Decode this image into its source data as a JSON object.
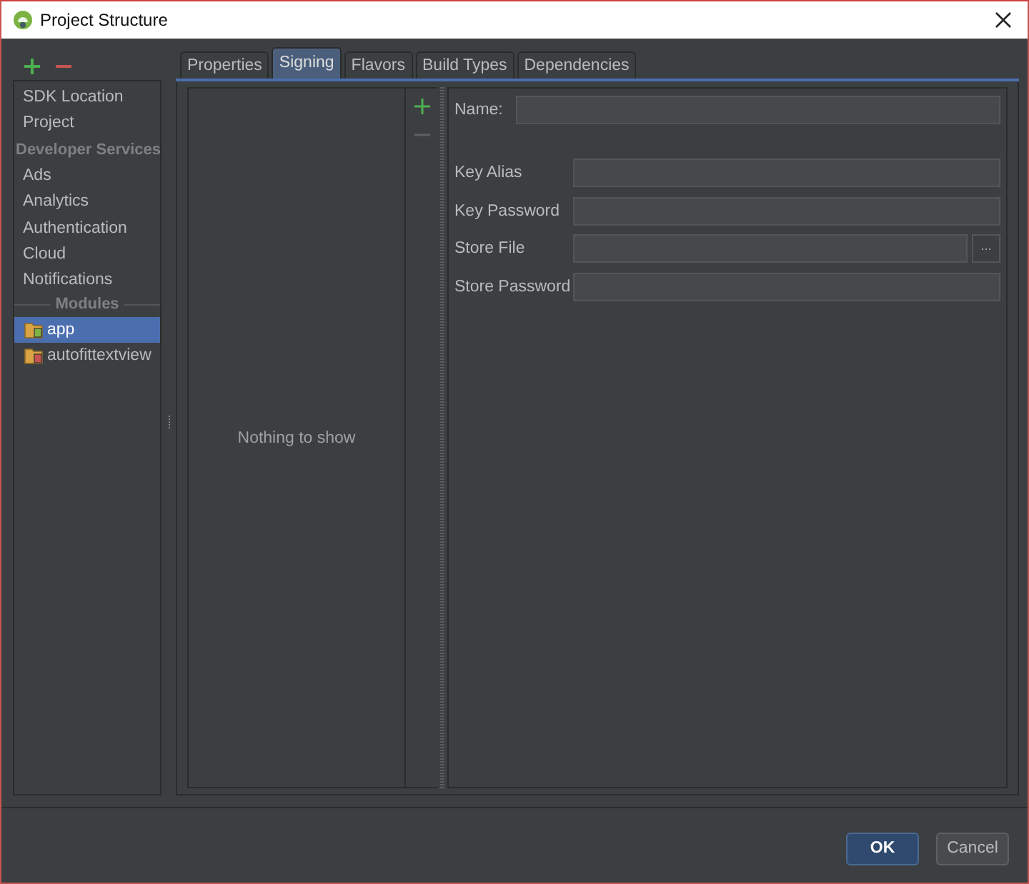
{
  "window": {
    "title": "Project Structure"
  },
  "sidebar": {
    "items": [
      {
        "kind": "item",
        "label": "SDK Location",
        "selected": false
      },
      {
        "kind": "item",
        "label": "Project",
        "selected": false
      },
      {
        "kind": "header",
        "label": "Developer Services"
      },
      {
        "kind": "item",
        "label": "Ads",
        "selected": false
      },
      {
        "kind": "item",
        "label": "Analytics",
        "selected": false
      },
      {
        "kind": "item",
        "label": "Authentication",
        "selected": false
      },
      {
        "kind": "item",
        "label": "Cloud",
        "selected": false
      },
      {
        "kind": "item",
        "label": "Notifications",
        "selected": false
      },
      {
        "kind": "separator",
        "label": "Modules"
      },
      {
        "kind": "app-module",
        "label": "app",
        "selected": true
      },
      {
        "kind": "library-module",
        "label": "autofittextview",
        "selected": false
      }
    ]
  },
  "tabs": [
    {
      "label": "Properties",
      "selected": false
    },
    {
      "label": "Signing",
      "selected": true
    },
    {
      "label": "Flavors",
      "selected": false
    },
    {
      "label": "Build Types",
      "selected": false
    },
    {
      "label": "Dependencies",
      "selected": false
    }
  ],
  "signing_list": {
    "empty_text": "Nothing to show"
  },
  "form": {
    "name_label": "Name:",
    "fields": [
      {
        "label": "Key Alias",
        "browse": false
      },
      {
        "label": "Key Password",
        "browse": false
      },
      {
        "label": "Store File",
        "browse": true,
        "browse_label": "..."
      },
      {
        "label": "Store Password",
        "browse": false
      }
    ]
  },
  "buttons": [
    {
      "label": "OK",
      "default": true
    },
    {
      "label": "Cancel",
      "default": false
    }
  ]
}
